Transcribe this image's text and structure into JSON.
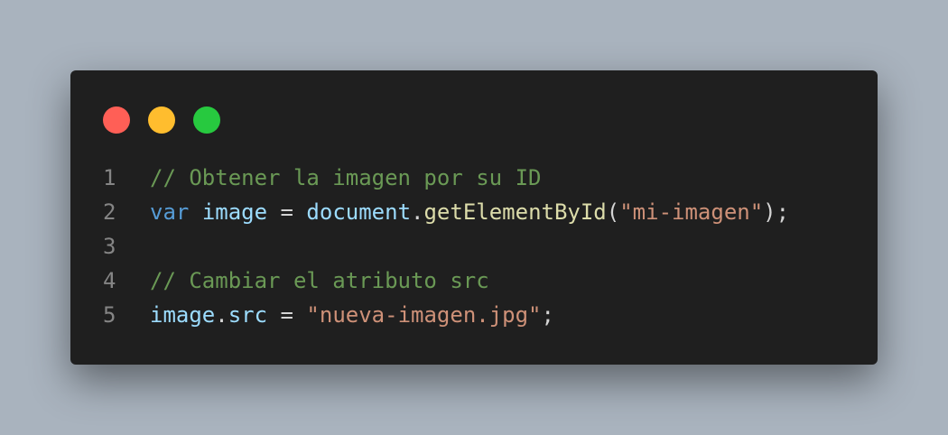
{
  "colors": {
    "background": "#a9b3be",
    "editor_background": "#1f1f1f",
    "line_number": "#858585",
    "plain": "#d4d4d4",
    "comment": "#6a9955",
    "keyword": "#569cd6",
    "variable": "#9cdcfe",
    "function": "#dcdcaa",
    "string": "#ce9178"
  },
  "window_controls": [
    {
      "name": "close",
      "color": "#ff5f56"
    },
    {
      "name": "minimize",
      "color": "#ffbd2e"
    },
    {
      "name": "maximize",
      "color": "#27c93f"
    }
  ],
  "code": {
    "lines": [
      {
        "number": "1",
        "tokens": [
          {
            "text": "// Obtener la imagen por su ID",
            "kind": "comment"
          }
        ]
      },
      {
        "number": "2",
        "tokens": [
          {
            "text": "var",
            "kind": "keyword"
          },
          {
            "text": " ",
            "kind": "plain"
          },
          {
            "text": "image",
            "kind": "variable"
          },
          {
            "text": " = ",
            "kind": "plain"
          },
          {
            "text": "document",
            "kind": "variable"
          },
          {
            "text": ".",
            "kind": "plain"
          },
          {
            "text": "getElementById",
            "kind": "function"
          },
          {
            "text": "(",
            "kind": "plain"
          },
          {
            "text": "\"mi-imagen\"",
            "kind": "string"
          },
          {
            "text": ");",
            "kind": "plain"
          }
        ]
      },
      {
        "number": "3",
        "tokens": []
      },
      {
        "number": "4",
        "tokens": [
          {
            "text": "// Cambiar el atributo src",
            "kind": "comment"
          }
        ]
      },
      {
        "number": "5",
        "tokens": [
          {
            "text": "image",
            "kind": "variable"
          },
          {
            "text": ".",
            "kind": "plain"
          },
          {
            "text": "src",
            "kind": "variable"
          },
          {
            "text": " = ",
            "kind": "plain"
          },
          {
            "text": "\"nueva-imagen.jpg\"",
            "kind": "string"
          },
          {
            "text": ";",
            "kind": "plain"
          }
        ]
      }
    ]
  }
}
